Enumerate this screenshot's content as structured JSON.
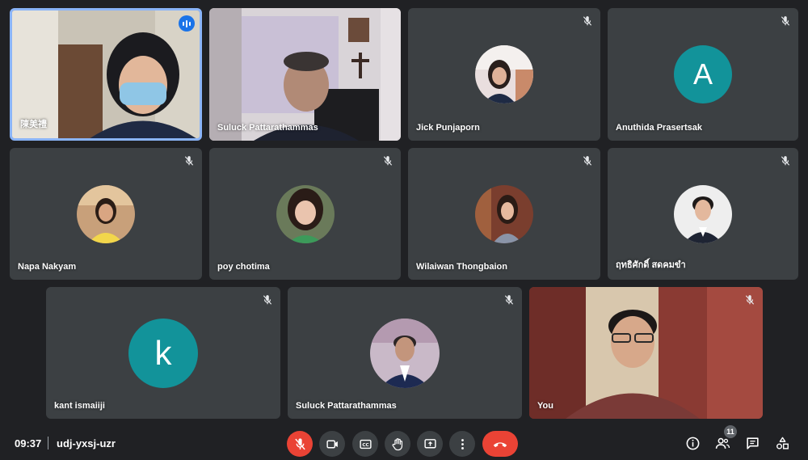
{
  "meeting": {
    "time": "09:37",
    "code": "udj-yxsj-uzr",
    "participant_count": "11"
  },
  "participants": [
    {
      "name": "陳美禮"
    },
    {
      "name": "Suluck Pattarathammas"
    },
    {
      "name": "Jick Punjaporn"
    },
    {
      "name": "Anuthida Prasertsak",
      "initial": "A"
    },
    {
      "name": "Napa Nakyam"
    },
    {
      "name": "poy chotima"
    },
    {
      "name": "Wilaiwan Thongbaion"
    },
    {
      "name": "ฤทธิศักดิ์ สดคมขำ"
    },
    {
      "name": "kant ismaiiji",
      "initial": "k"
    },
    {
      "name": "Suluck Pattarathammas"
    },
    {
      "name": "You"
    }
  ],
  "colors": {
    "accent": "#8ab4f8",
    "avatar_teal": "#12939a",
    "danger": "#ea4335",
    "tile": "#3c4043",
    "background": "#202124"
  }
}
